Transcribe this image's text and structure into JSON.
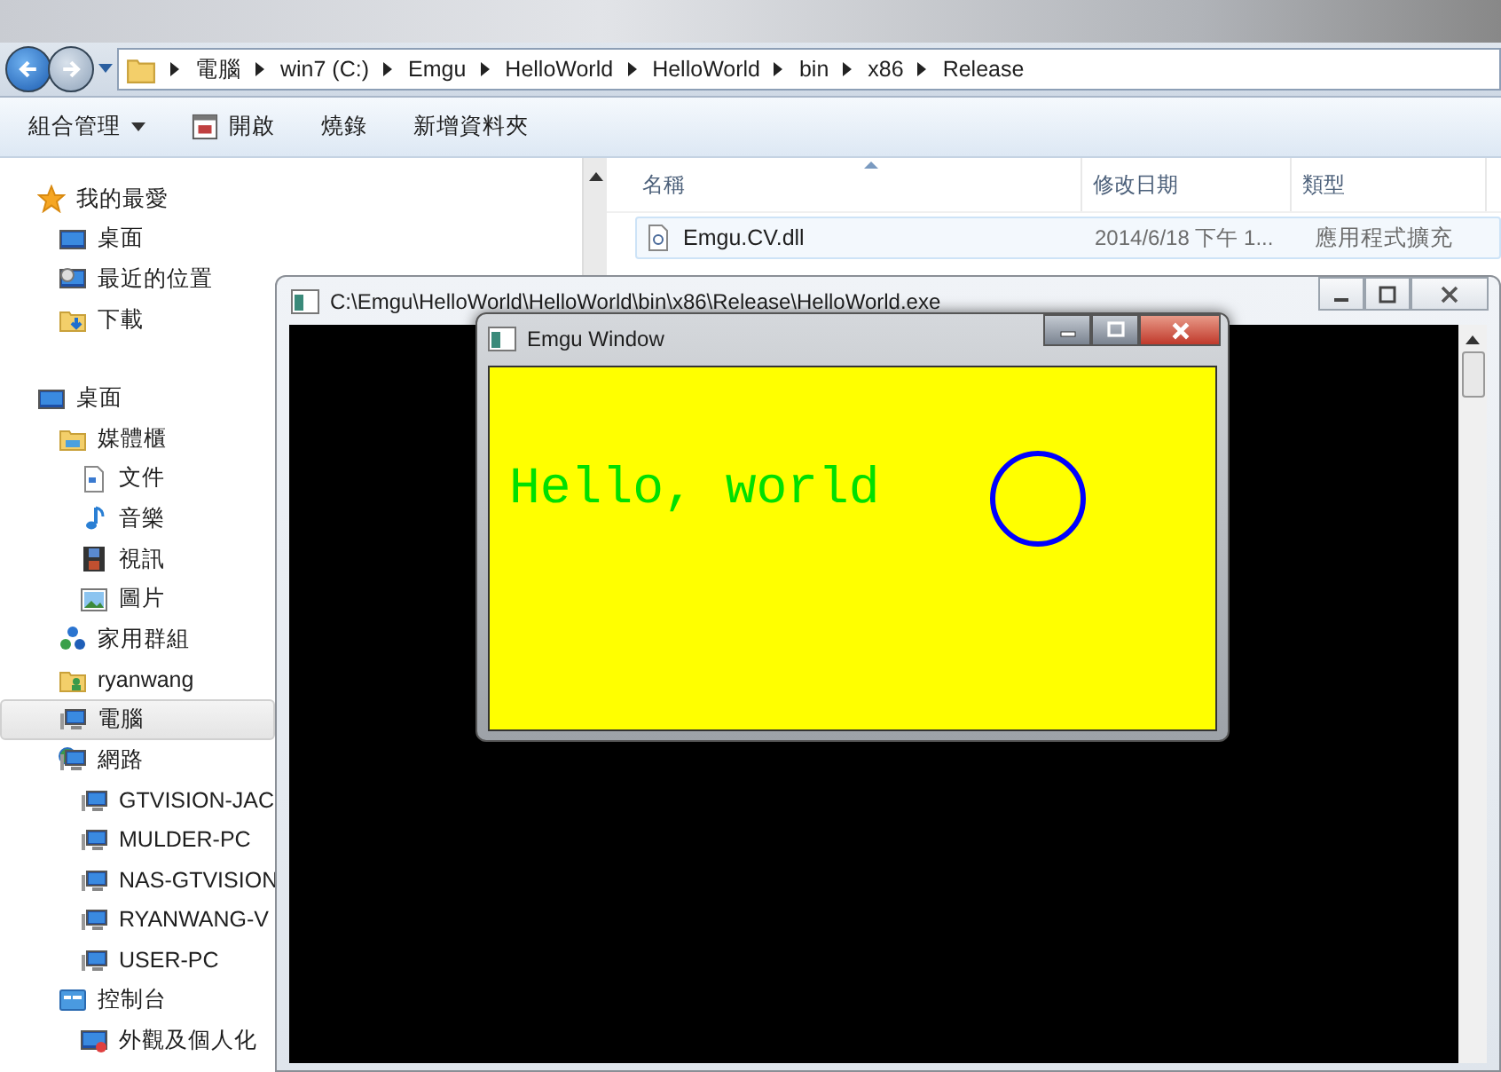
{
  "explorer": {
    "breadcrumb": [
      "電腦",
      "win7 (C:)",
      "Emgu",
      "HelloWorld",
      "HelloWorld",
      "bin",
      "x86",
      "Release"
    ],
    "toolbar": [
      {
        "label": "組合管理",
        "kind": "menu"
      },
      {
        "label": "開啟",
        "kind": "open"
      },
      {
        "label": "燒錄",
        "kind": "plain"
      },
      {
        "label": "新增資料夾",
        "kind": "plain"
      }
    ],
    "sidebar": [
      {
        "label": "我的最愛",
        "kind": "star",
        "selected": false,
        "children": [
          {
            "label": "桌面",
            "kind": "desktop",
            "selected": false
          },
          {
            "label": "最近的位置",
            "kind": "recent",
            "selected": false
          },
          {
            "label": "下載",
            "kind": "download",
            "selected": false
          }
        ]
      },
      {
        "label": "桌面",
        "kind": "desktop",
        "selected": false,
        "children": [
          {
            "label": "媒體櫃",
            "kind": "library",
            "selected": false,
            "children": [
              {
                "label": "文件",
                "kind": "document",
                "selected": false
              },
              {
                "label": "音樂",
                "kind": "music",
                "selected": false
              },
              {
                "label": "視訊",
                "kind": "video",
                "selected": false
              },
              {
                "label": "圖片",
                "kind": "picture",
                "selected": false
              }
            ]
          },
          {
            "label": "家用群組",
            "kind": "homegroup",
            "selected": false
          },
          {
            "label": "ryanwang",
            "kind": "user",
            "selected": false
          },
          {
            "label": "電腦",
            "kind": "computer",
            "selected": true
          },
          {
            "label": "網路",
            "kind": "network",
            "selected": false,
            "children": [
              {
                "label": "GTVISION-JAC",
                "kind": "computer",
                "selected": false
              },
              {
                "label": "MULDER-PC",
                "kind": "computer",
                "selected": false
              },
              {
                "label": "NAS-GTVISION",
                "kind": "computer",
                "selected": false
              },
              {
                "label": "RYANWANG-V",
                "kind": "computer",
                "selected": false
              },
              {
                "label": "USER-PC",
                "kind": "computer",
                "selected": false
              }
            ]
          },
          {
            "label": "控制台",
            "kind": "control",
            "selected": false,
            "children": [
              {
                "label": "外觀及個人化",
                "kind": "appearance",
                "selected": false
              }
            ]
          }
        ]
      }
    ],
    "columns": [
      "名稱",
      "修改日期",
      "類型"
    ],
    "files": [
      {
        "name": "Emgu.CV.dll",
        "modified": "2014/6/18 下午 1...",
        "type": "應用程式擴充"
      }
    ]
  },
  "console": {
    "title": "C:\\Emgu\\HelloWorld\\HelloWorld\\bin\\x86\\Release\\HelloWorld.exe"
  },
  "emgu_window": {
    "title": "Emgu Window",
    "text": "Hello, world"
  }
}
